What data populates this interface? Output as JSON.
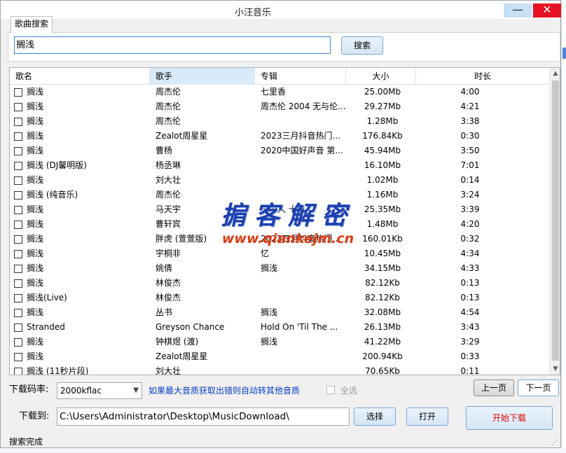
{
  "window": {
    "title": "小汪音乐"
  },
  "titlebar": {
    "minimize_label": "—",
    "close_label": "✕"
  },
  "tab": {
    "label": "歌曲搜索"
  },
  "search": {
    "value": "搁浅",
    "button_label": "搜索"
  },
  "columns": [
    "歌名",
    "歌手",
    "专辑",
    "大小",
    "时长"
  ],
  "songs": [
    {
      "name": "搁浅",
      "artist": "周杰伦",
      "album": "七里香",
      "size": "25.00Mb",
      "duration": "4:00"
    },
    {
      "name": "搁浅",
      "artist": "周杰伦",
      "album": "周杰伦 2004 无与伦...",
      "size": "29.27Mb",
      "duration": "4:21"
    },
    {
      "name": "搁浅",
      "artist": "周杰伦",
      "album": "",
      "size": "1.28Mb",
      "duration": "3:38"
    },
    {
      "name": "搁浅",
      "artist": "Zealot周星星",
      "album": "2023三月抖音热门...",
      "size": "176.84Kb",
      "duration": "0:30"
    },
    {
      "name": "搁浅",
      "artist": "曹杨",
      "album": "2020中国好声音 第...",
      "size": "45.94Mb",
      "duration": "3:50"
    },
    {
      "name": "搁浅 (DJ馨明版)",
      "artist": "杨丞琳",
      "album": "",
      "size": "16.10Mb",
      "duration": "7:01"
    },
    {
      "name": "搁浅",
      "artist": "刘大壮",
      "album": "",
      "size": "1.02Mb",
      "duration": "0:14"
    },
    {
      "name": "搁浅 (纯音乐)",
      "artist": "周杰伦",
      "album": "",
      "size": "1.16Mb",
      "duration": "3:24"
    },
    {
      "name": "搁浅",
      "artist": "马天宇",
      "album": "一个人 十色",
      "size": "25.35Mb",
      "duration": "3:39"
    },
    {
      "name": "搁浅",
      "artist": "曹轩宾",
      "album": "",
      "size": "1.48Mb",
      "duration": "4:20"
    },
    {
      "name": "搁浅",
      "artist": "胖虎 (萱萱版)",
      "album": "2023四月抖音热门...",
      "size": "160.01Kb",
      "duration": "0:32"
    },
    {
      "name": "搁浅",
      "artist": "宇桐非",
      "album": "忆",
      "size": "10.45Mb",
      "duration": "4:34"
    },
    {
      "name": "搁浅",
      "artist": "姚倩",
      "album": "搁浅",
      "size": "34.15Mb",
      "duration": "4:33"
    },
    {
      "name": "搁浅",
      "artist": "林俊杰",
      "album": "",
      "size": "82.12Kb",
      "duration": "0:13"
    },
    {
      "name": "搁浅(Live)",
      "artist": "林俊杰",
      "album": "",
      "size": "82.12Kb",
      "duration": "0:13"
    },
    {
      "name": "搁浅",
      "artist": "丛书",
      "album": "搁浅",
      "size": "32.08Mb",
      "duration": "4:54"
    },
    {
      "name": "Stranded",
      "artist": "Greyson Chance",
      "album": "Hold On  'Til The ...",
      "size": "26.13Mb",
      "duration": "3:43"
    },
    {
      "name": "搁浅",
      "artist": "钟棋煜 (渡)",
      "album": "搁浅",
      "size": "41.22Mb",
      "duration": "3:29"
    },
    {
      "name": "搁浅",
      "artist": "Zealot周星星",
      "album": "",
      "size": "200.94Kb",
      "duration": "0:33"
    },
    {
      "name": "搁浅 (11秒片段)",
      "artist": "刘大壮",
      "album": "",
      "size": "70.65Kb",
      "duration": "0:11"
    }
  ],
  "watermark": {
    "title": "掮客解密",
    "url": "www.qiankejm.cn"
  },
  "download": {
    "bitrate_label": "下载码率:",
    "bitrate_value": "2000kflac",
    "hint": "如果最大音质获取出错则自动转其他音质",
    "select_all_label": "全选",
    "prev_page": "上一页",
    "next_page": "下一页",
    "save_to_label": "下载到:",
    "path": "C:\\Users\\Administrator\\Desktop\\MusicDownload\\",
    "choose_label": "选择",
    "open_label": "打开",
    "start_label": "开始下载"
  },
  "status": {
    "text": "搜索完成"
  },
  "colors": {
    "accent": "#3d87d8",
    "start_button_text": "#e00000",
    "hint_text": "#0a3cc8",
    "close_button": "#e81123"
  }
}
